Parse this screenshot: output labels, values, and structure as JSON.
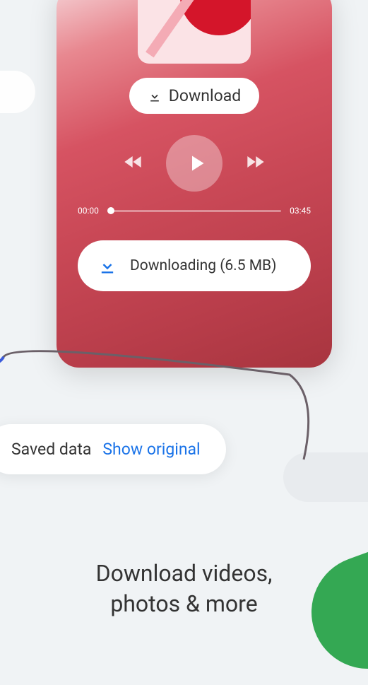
{
  "download_button": {
    "label": "Download"
  },
  "player": {
    "current_time": "00:00",
    "total_time": "03:45"
  },
  "downloading_status": {
    "label": "Downloading (6.5 MB)"
  },
  "saved_data": {
    "label": "Saved data",
    "link": "Show original"
  },
  "headline": {
    "line1": "Download videos,",
    "line2": "photos & more"
  },
  "colors": {
    "accent_blue": "#1a73e8",
    "accent_green": "#34a853"
  }
}
